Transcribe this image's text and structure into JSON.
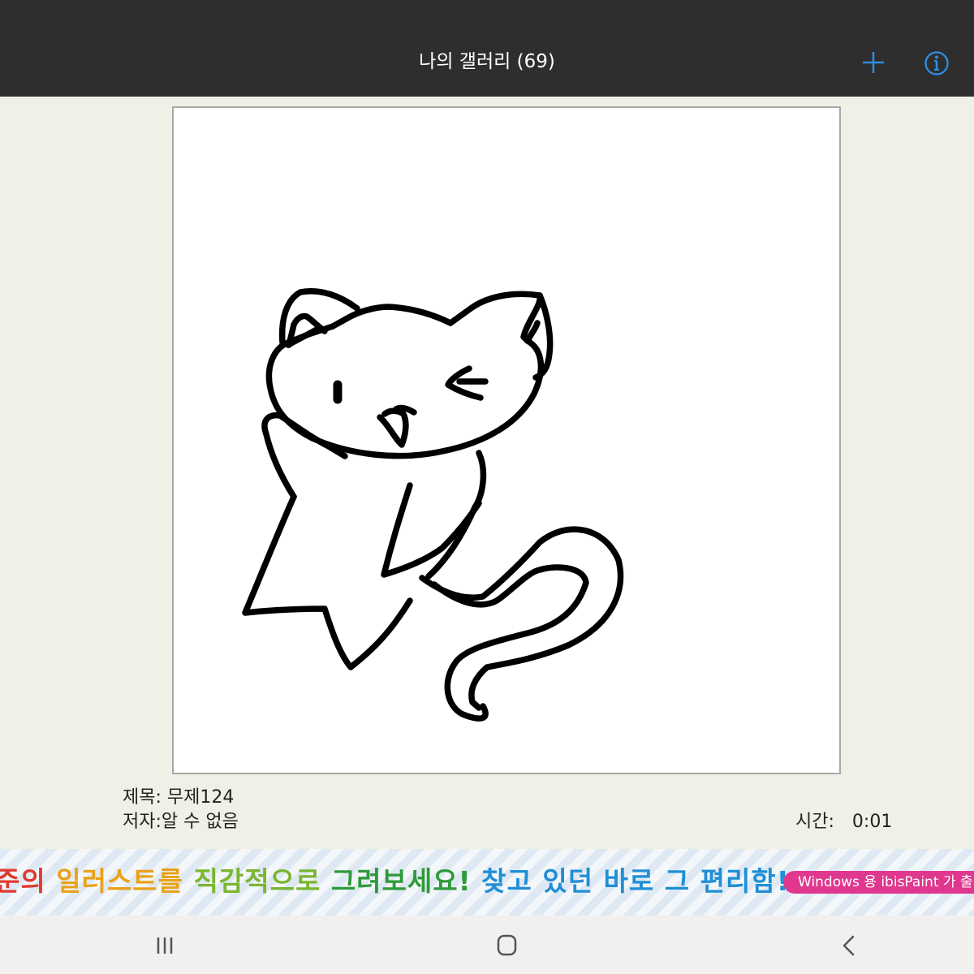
{
  "header": {
    "title": "나의 갤러리 (69)",
    "add_icon": "plus-icon",
    "info_icon": "info-icon",
    "accent_color": "#2f8ee0"
  },
  "artwork": {
    "title_label": "제목: 무제124",
    "author_label": "저자:알 수 없음",
    "time_label": "시간:",
    "time_value": "0:01"
  },
  "ad": {
    "segments": [
      "준의 ",
      "일러스트를 ",
      "직감적으로 ",
      "그려보세요! ",
      "찾고 있던 바로 그 편리함!"
    ],
    "pill_text": "Windows 용 ibisPaint 가 출시"
  },
  "navbar": {
    "recents_icon": "recents-icon",
    "home_icon": "home-icon",
    "back_icon": "back-icon"
  }
}
